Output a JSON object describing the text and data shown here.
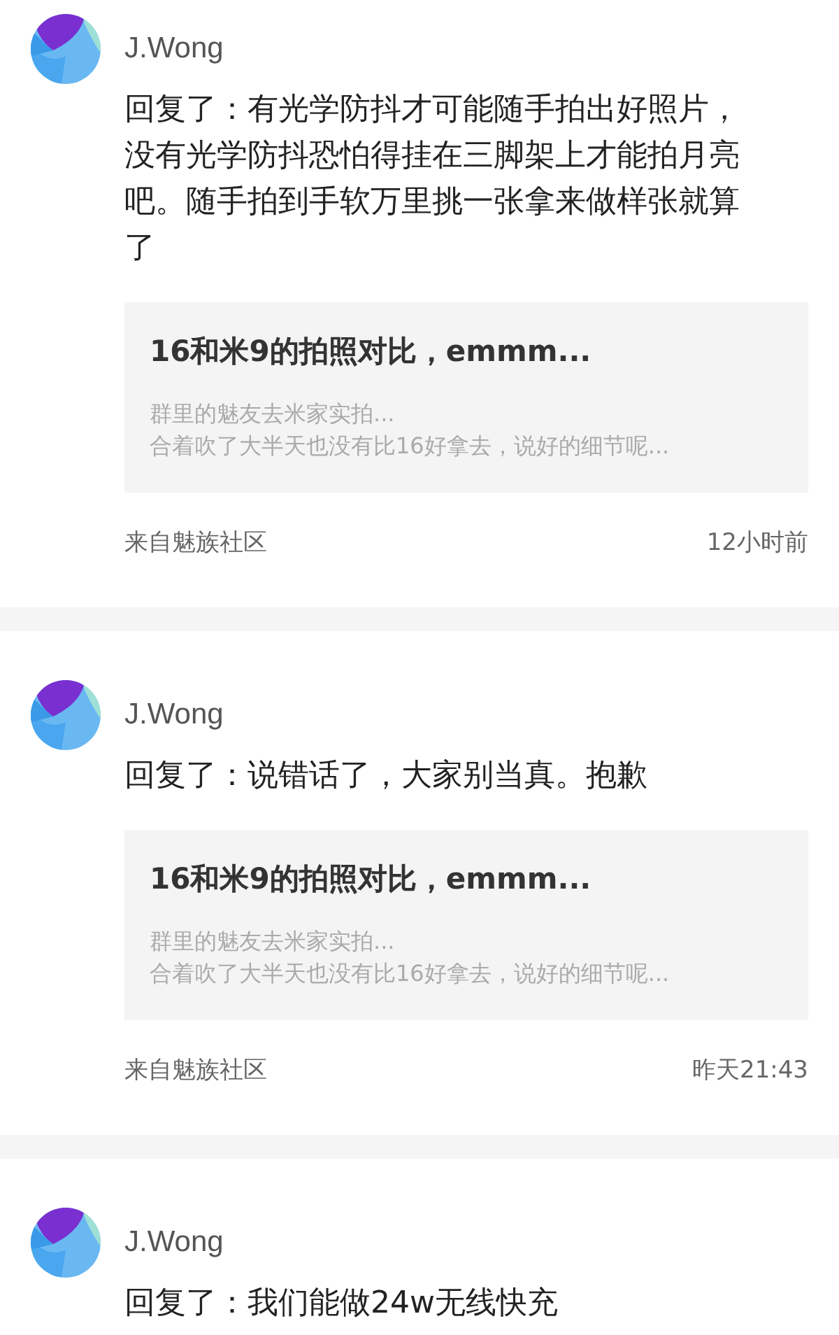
{
  "posts": [
    {
      "author": "J.Wong",
      "reply": "回复了：有光学防抖才可能随手拍出好照片，没有光学防抖恐怕得挂在三脚架上才能拍月亮吧。随手拍到手软万里挑一张拿来做样张就算了",
      "quote": {
        "title": "16和米9的拍照对比，emmm...",
        "excerpt_lines": [
          "群里的魅友去米家实拍...",
          "合着吹了大半天也没有比16好拿去，说好的细节呢..."
        ]
      },
      "source": "来自魅族社区",
      "time": "12小时前"
    },
    {
      "author": "J.Wong",
      "reply": "回复了：说错话了，大家别当真。抱歉",
      "quote": {
        "title": "16和米9的拍照对比，emmm...",
        "excerpt_lines": [
          "群里的魅友去米家实拍...",
          "合着吹了大半天也没有比16好拿去，说好的细节呢..."
        ]
      },
      "source": "来自魅族社区",
      "time": "昨天21:43"
    },
    {
      "author": "J.Wong",
      "reply": "回复了：我们能做24w无线快充"
    }
  ]
}
